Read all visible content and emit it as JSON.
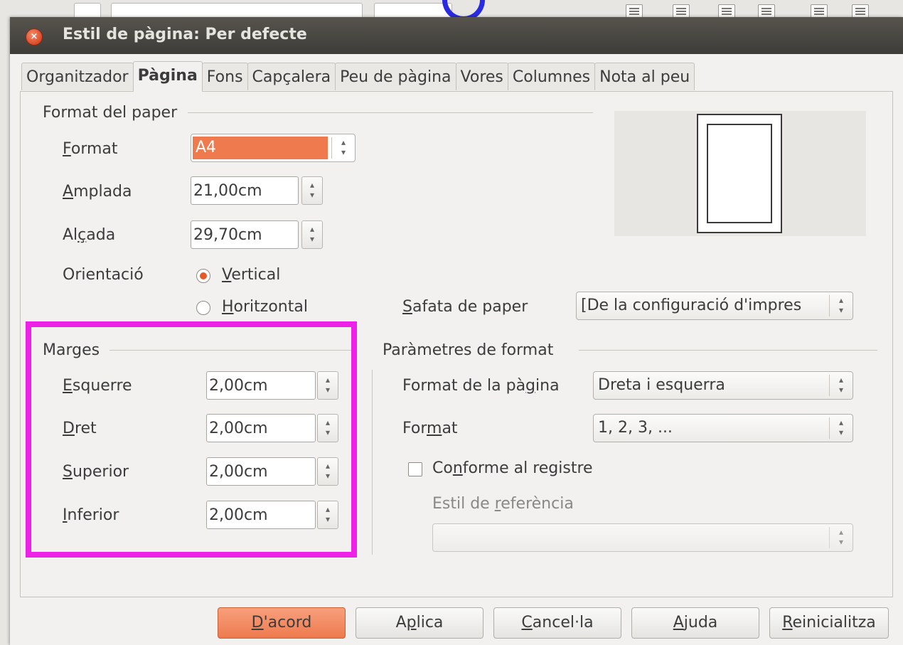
{
  "dialog": {
    "title": "Estil de pàgina: Per defecte",
    "close_glyph": "×"
  },
  "tabs": [
    {
      "label": "Organitzador"
    },
    {
      "label": "Pàgina"
    },
    {
      "label": "Fons"
    },
    {
      "label": "Capçalera"
    },
    {
      "label": "Peu de pàgina"
    },
    {
      "label": "Vores"
    },
    {
      "label": "Columnes"
    },
    {
      "label": "Nota al peu"
    }
  ],
  "active_tab": "Pàgina",
  "paper_format": {
    "section": "Format del paper",
    "format": {
      "pre": "",
      "mn": "F",
      "post": "ormat",
      "value": "A4"
    },
    "width": {
      "pre": "",
      "mn": "A",
      "post": "mplada",
      "value": "21,00cm"
    },
    "height": {
      "pre": "Al",
      "mn": "ç",
      "post": "ada",
      "value": "29,70cm"
    },
    "orientation": {
      "label": "Orientació",
      "portrait": {
        "pre": "",
        "mn": "V",
        "post": "ertical",
        "selected": true
      },
      "landscape": {
        "pre": "",
        "mn": "H",
        "post": "oritzontal",
        "selected": false
      }
    },
    "tray": {
      "pre": "",
      "mn": "S",
      "post": "afata de paper",
      "value": "[De la configuració d'impres"
    }
  },
  "margins": {
    "section": "Marges",
    "left": {
      "pre": "",
      "mn": "E",
      "post": "squerre",
      "value": "2,00cm"
    },
    "right": {
      "pre": "",
      "mn": "D",
      "post": "ret",
      "value": "2,00cm"
    },
    "top": {
      "pre": "",
      "mn": "S",
      "post": "uperior",
      "value": "2,00cm"
    },
    "bottom": {
      "pre": "",
      "mn": "I",
      "post": "nferior",
      "value": "2,00cm"
    }
  },
  "layout": {
    "section": "Paràmetres de format",
    "page_layout": {
      "pre": "Format de la pà",
      "mn": "g",
      "post": "ina",
      "value": "Dreta i esquerra"
    },
    "numbering": {
      "pre": "For",
      "mn": "m",
      "post": "at",
      "value": "1, 2, 3, ..."
    },
    "register_true": {
      "pre": "Co",
      "mn": "n",
      "post": "forme al registre",
      "checked": false
    },
    "reference_style": {
      "pre": "Estil de ",
      "mn": "r",
      "post": "eferència",
      "value": ""
    }
  },
  "buttons": {
    "ok": {
      "pre": "",
      "mn": "D",
      "post": "'acord"
    },
    "apply": {
      "pre": "A",
      "mn": "p",
      "post": "lica"
    },
    "cancel": {
      "pre": "",
      "mn": "C",
      "post": "ancel·la"
    },
    "help": {
      "pre": "",
      "mn": "A",
      "post": "juda"
    },
    "reset": {
      "pre": "",
      "mn": "R",
      "post": "einicialitza"
    }
  },
  "colors": {
    "highlight": "#ee22e6",
    "selected_format_bg": "#ee7a4e",
    "primary_button": "#ee7a4e",
    "titlebar": "#3e3c38",
    "radio_selected": "#e8592a"
  }
}
